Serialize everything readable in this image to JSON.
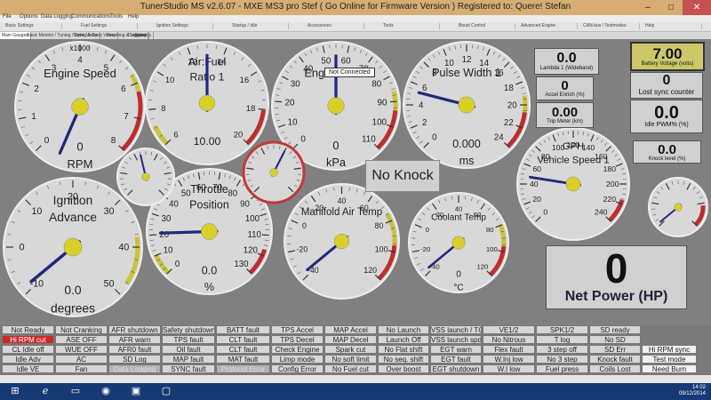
{
  "window": {
    "title": "TunerStudio MS v2.6.07 - MXE MS3 pro Stef ( Go Online for Firmware Version ) Registered to: Quere! Stefan",
    "minimize": "–",
    "maximize": "□",
    "close": "✕"
  },
  "menu": [
    "File",
    "Options",
    "Data Logging",
    "Communications",
    "Tools",
    "Help"
  ],
  "toolbar": [
    "Basic Settings",
    "Fuel Settings",
    "Ignition Settings",
    "Startup / Idle",
    "Accessories",
    "Tools",
    "Boost Control",
    "Advanced Engine",
    "CAN-bus / Testmodes",
    "Help"
  ],
  "tabs": [
    {
      "label": "Main Gauges",
      "active": true
    },
    {
      "label": "Basic Monitor / Tuning / Dyno Views",
      "active": false
    },
    {
      "label": "Tuning & Dyno Views",
      "active": false
    },
    {
      "label": "Graphing & Logging",
      "active": false
    },
    {
      "label": "Diagnostics",
      "active": false
    },
    {
      "label": "Notes",
      "active": false
    }
  ],
  "tooltip": "Not Connected",
  "no_knock": "No Knock",
  "gauges": {
    "engine_speed": {
      "title_top": "x1000",
      "title": "Engine Speed",
      "value": "0",
      "unit": "RPM",
      "ticks": [
        "0",
        "1",
        "2",
        "3",
        "4",
        "5",
        "6",
        "7",
        "8"
      ]
    },
    "air_fuel": {
      "title": "Air:Fuel",
      "title2": "Ratio 1",
      "value": "10.00",
      "unit": "",
      "ticks": [
        "6",
        "8",
        "10",
        "12",
        "14",
        "16",
        "18",
        "20"
      ]
    },
    "engine_map": {
      "title": "Engine MAP",
      "value": "0",
      "unit": "kPa",
      "ticks": [
        "0",
        "10",
        "20",
        "30",
        "40",
        "50",
        "60",
        "70",
        "80",
        "90",
        "100",
        "110"
      ]
    },
    "pulse_width": {
      "title": "Pulse Width 1",
      "value": "0.000",
      "unit": "ms",
      "ticks": [
        "0",
        "2",
        "4",
        "6",
        "8",
        "10",
        "12",
        "14",
        "16",
        "18",
        "20",
        "22",
        "24"
      ]
    },
    "vehicle_speed": {
      "title": "GPH",
      "title2": "Vehicle Speed 1",
      "value": "",
      "unit": "",
      "ticks": [
        "0",
        "20",
        "40",
        "60",
        "80",
        "100",
        "120",
        "140",
        "160",
        "180",
        "200",
        "220",
        "240"
      ]
    },
    "ignition_advance": {
      "title": "Ignition",
      "title2": "Advance",
      "value": "0.0",
      "unit": "degrees",
      "ticks": [
        "-10",
        "0",
        "10",
        "20",
        "30",
        "40",
        "50"
      ]
    },
    "throttle_position": {
      "title": "Throttle",
      "title2": "Position",
      "value": "0.0",
      "unit": "%",
      "ticks": [
        "0",
        "10",
        "20",
        "30",
        "40",
        "50",
        "60",
        "70",
        "80",
        "90",
        "100",
        "110",
        "120",
        "130"
      ]
    },
    "manifold_air_temp": {
      "title": "Manifold Air Temp",
      "value": "",
      "unit": "",
      "ticks": [
        "-40",
        "-20",
        "0",
        "20",
        "40",
        "60",
        "80",
        "100",
        "120"
      ]
    },
    "coolant_temp": {
      "title": "Coolant Temp",
      "value": "0",
      "unit": "°C",
      "ticks": [
        "-40",
        "-20",
        "0",
        "20",
        "40",
        "60",
        "80",
        "100",
        "120"
      ]
    }
  },
  "digital": [
    {
      "value": "0.0",
      "label": "Lambda 1 (Wideband)"
    },
    {
      "value": "0",
      "label": "Accel Enrich (%)"
    },
    {
      "value": "0.00",
      "label": "Trip Meter (km)"
    },
    {
      "value": "7.00",
      "label": "Battery Voltage (volts)"
    },
    {
      "value": "0",
      "label": "Lost sync counter"
    },
    {
      "value": "0.0",
      "label": "Idle PWM% (%)"
    },
    {
      "value": "0.0",
      "label": "Knock level (%)"
    }
  ],
  "net_power": {
    "value": "0",
    "label": "Net Power (HP)"
  },
  "indicator_columns": [
    [
      "Not Ready",
      "Hi RPM cut",
      "CL Idle off",
      "Idle Adv",
      "Idle VE"
    ],
    [
      "Not Cranking",
      "ASE OFF",
      "WUE OFF",
      "AC",
      "Fan"
    ],
    [
      "AFR shutdown",
      "AFR warn",
      "AFR0 fault",
      "SD Log",
      "Data Logging"
    ],
    [
      "Safety shutdown",
      "TPS fault",
      "Oil fault",
      "MAP fault",
      "SYNC fault"
    ],
    [
      "BATT fault",
      "CLT fault",
      "CLT fault",
      "MAT fault",
      "Protocol Error"
    ],
    [
      "TPS Accel",
      "TPS Decel",
      "Check Engine",
      "Limp mode",
      "Config Error"
    ],
    [
      "MAP Accel",
      "MAP Decel",
      "Spark cut",
      "No soft limit",
      "No Fuel cut"
    ],
    [
      "No Launch",
      "Launch Off",
      "No Flat shift",
      "No seq. shift",
      "Over boost"
    ],
    [
      "VSS launch / TC",
      "VSS launch spd",
      "EGT warn",
      "EGT fault",
      "EGT shutdown"
    ],
    [
      "VE1/2",
      "No Nitrous",
      "Flex fault",
      "W.Inj low",
      "W.I low"
    ],
    [
      "SPK1/2",
      "T log",
      "3 step off",
      "No 3 step",
      "Fuel press"
    ],
    [
      "SD ready",
      "No SD",
      "SD Err",
      "Knock fault",
      "Coils Lost"
    ],
    [
      "Hi RPM sync",
      "Test mode",
      "Need Burn"
    ]
  ],
  "clock": {
    "time": "14:02",
    "date": "09/12/2014"
  }
}
